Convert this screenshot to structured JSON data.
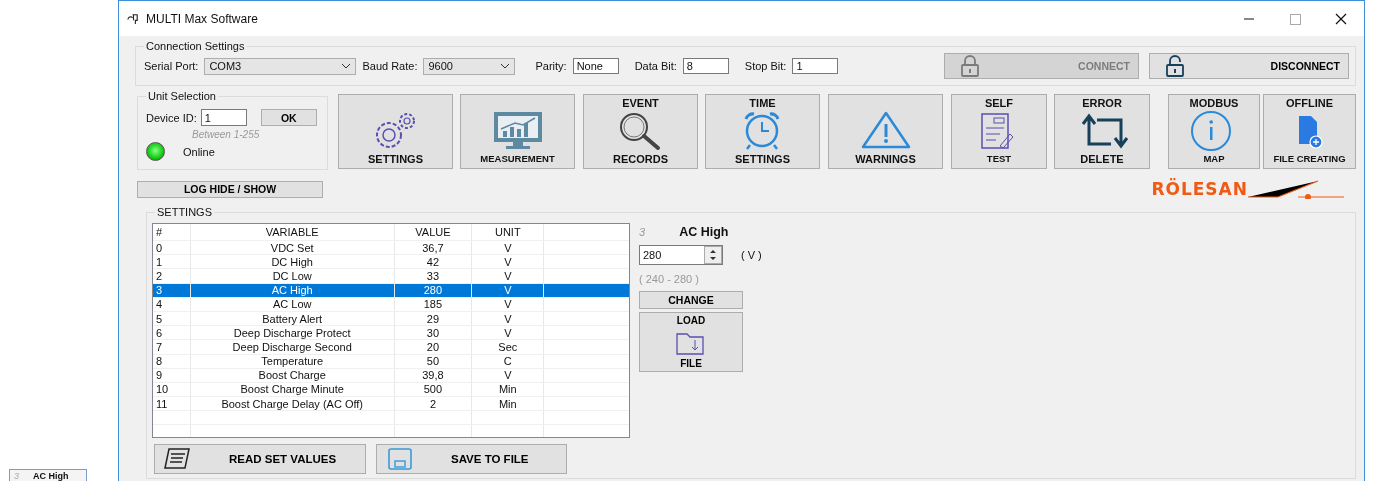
{
  "floating_label": {
    "index": "3",
    "title": "AC High"
  },
  "window": {
    "title": "MULTI Max Software"
  },
  "connection": {
    "legend": "Connection Settings",
    "fields": [
      {
        "kind": "combo",
        "label": "Serial Port:",
        "value": "COM3"
      },
      {
        "kind": "combo",
        "label": "Baud Rate:",
        "value": "9600"
      },
      {
        "kind": "text",
        "label": "Parity:",
        "value": "None"
      },
      {
        "kind": "text",
        "label": "Data Bit:",
        "value": "8"
      },
      {
        "kind": "text",
        "label": "Stop Bit:",
        "value": "1"
      }
    ],
    "buttons": [
      {
        "kind": "lock",
        "label": "CONNECT",
        "disabled": true
      },
      {
        "kind": "unlock",
        "label": "DISCONNECT",
        "disabled": false
      }
    ]
  },
  "unit_selection": {
    "legend": "Unit Selection",
    "label": "Device ID:",
    "value": "1",
    "ok": "OK",
    "hint": "Between 1-255",
    "online": true,
    "status": "Online"
  },
  "tools": [
    {
      "kind": "gears",
      "bottom": "SETTINGS"
    },
    {
      "kind": "monitor",
      "bottom": "MEASUREMENT"
    },
    {
      "kind": "magnifier",
      "top": "EVENT",
      "bottom": "RECORDS"
    },
    {
      "kind": "clock",
      "top": "TIME",
      "bottom": "SETTINGS"
    },
    {
      "kind": "warning",
      "bottom": "WARNINGS"
    },
    {
      "kind": "form",
      "top": "SELF",
      "bottom": "TEST"
    },
    {
      "kind": "cycle",
      "top": "ERROR",
      "bottom": "DELETE"
    },
    {
      "kind": "info",
      "top": "MODBUS",
      "bottom": "MAP"
    },
    {
      "kind": "file",
      "top": "OFFLINE",
      "bottom": "FILE CREATING"
    }
  ],
  "log_button": "LOG HIDE / SHOW",
  "logo": "RÖLESAN",
  "settings": {
    "legend": "SETTINGS",
    "table": {
      "columns": [
        "#",
        "VARIABLE",
        "VALUE",
        "UNIT"
      ],
      "rows": [
        {
          "index": "0",
          "variable": "VDC Set",
          "value": "36,7",
          "unit": "V",
          "selected": false
        },
        {
          "index": "1",
          "variable": "DC High",
          "value": "42",
          "unit": "V",
          "selected": false
        },
        {
          "index": "2",
          "variable": "DC Low",
          "value": "33",
          "unit": "V",
          "selected": false
        },
        {
          "index": "3",
          "variable": "AC High",
          "value": "280",
          "unit": "V",
          "selected": true
        },
        {
          "index": "4",
          "variable": "AC Low",
          "value": "185",
          "unit": "V",
          "selected": false
        },
        {
          "index": "5",
          "variable": "Battery Alert",
          "value": "29",
          "unit": "V",
          "selected": false
        },
        {
          "index": "6",
          "variable": "Deep Discharge Protect",
          "value": "30",
          "unit": "V",
          "selected": false
        },
        {
          "index": "7",
          "variable": "Deep Discharge Second",
          "value": "20",
          "unit": "Sec",
          "selected": false
        },
        {
          "index": "8",
          "variable": "Temperature",
          "value": "50",
          "unit": "C",
          "selected": false
        },
        {
          "index": "9",
          "variable": "Boost Charge",
          "value": "39,8",
          "unit": "V",
          "selected": false
        },
        {
          "index": "10",
          "variable": "Boost Charge Minute",
          "value": "500",
          "unit": "Min",
          "selected": false
        },
        {
          "index": "11",
          "variable": "Boost Charge Delay (AC Off)",
          "value": "2",
          "unit": "Min",
          "selected": false
        }
      ]
    },
    "editor": {
      "index": "3",
      "title": "AC High",
      "value": "280",
      "unit": "( V )",
      "range": "( 240 - 280 )",
      "change": "CHANGE",
      "load_top": "LOAD",
      "load_bottom": "FILE"
    },
    "bottom_buttons": [
      {
        "kind": "scroll",
        "label": "READ SET VALUES"
      },
      {
        "kind": "disk",
        "label": "SAVE TO FILE"
      }
    ]
  }
}
